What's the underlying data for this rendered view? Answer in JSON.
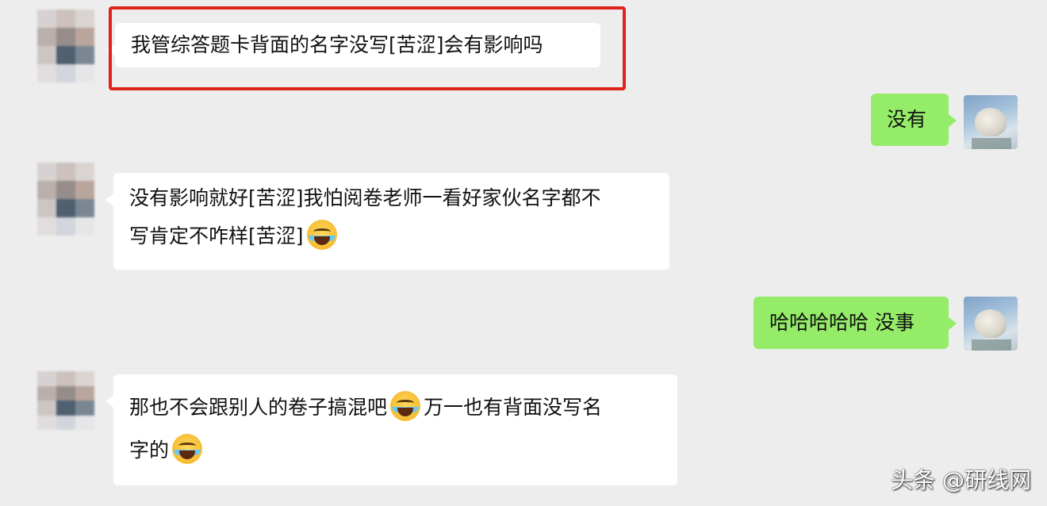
{
  "messages": [
    {
      "side": "left",
      "text": "我管综答题卡背面的名字没写[苦涩]会有影响吗",
      "highlighted": true
    },
    {
      "side": "right",
      "text": "没有"
    },
    {
      "side": "left",
      "line1": "没有影响就好[苦涩]我怕阅卷老师一看好家伙名字都不",
      "line2": "写肯定不咋样[苦涩]",
      "emoji": "laughing-crying-emoji"
    },
    {
      "side": "right",
      "text": "哈哈哈哈哈 没事"
    },
    {
      "side": "left",
      "line1_a": "那也不会跟别人的卷子搞混吧",
      "line1_b": "万一也有背面没写名",
      "line2": "字的",
      "emoji": "laughing-crying-emoji"
    }
  ],
  "watermark": "头条 @研线网",
  "colors": {
    "background": "#ededed",
    "incoming_bubble": "#ffffff",
    "outgoing_bubble": "#95ec69",
    "highlight_frame": "#e0221c"
  }
}
